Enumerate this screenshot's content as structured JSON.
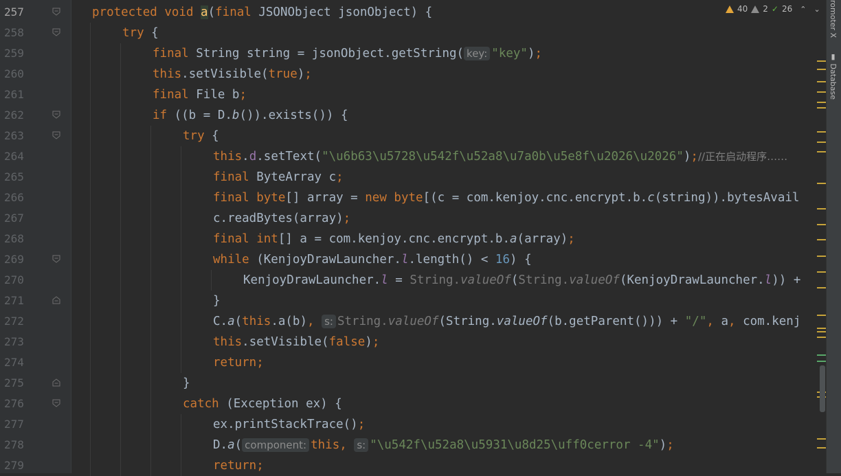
{
  "editor": {
    "lines": [
      {
        "n": "257",
        "indent": 0,
        "fold": "open",
        "tokens": [
          {
            "t": "protected void ",
            "c": "kw"
          },
          {
            "t": "a",
            "c": "hlname"
          },
          {
            "t": "(",
            "c": ""
          },
          {
            "t": "final ",
            "c": "kw"
          },
          {
            "t": "JSONObject jsonObject) {",
            "c": ""
          }
        ]
      },
      {
        "n": "258",
        "indent": 1,
        "fold": "open",
        "tokens": [
          {
            "t": "try ",
            "c": "kw"
          },
          {
            "t": "{",
            "c": ""
          }
        ]
      },
      {
        "n": "259",
        "indent": 2,
        "fold": "",
        "tokens": [
          {
            "t": "final ",
            "c": "kw"
          },
          {
            "t": "String string = jsonObject.getString(",
            "c": ""
          },
          {
            "t": "key:",
            "c": "hint"
          },
          {
            "t": "\"key\"",
            "c": "str"
          },
          {
            "t": ")",
            "c": ""
          },
          {
            "t": ";",
            "c": "kw"
          }
        ]
      },
      {
        "n": "260",
        "indent": 2,
        "fold": "",
        "tokens": [
          {
            "t": "this",
            "c": "kw"
          },
          {
            "t": ".setVisible(",
            "c": ""
          },
          {
            "t": "true",
            "c": "kw"
          },
          {
            "t": ")",
            "c": ""
          },
          {
            "t": ";",
            "c": "kw"
          }
        ]
      },
      {
        "n": "261",
        "indent": 2,
        "fold": "",
        "tokens": [
          {
            "t": "final ",
            "c": "kw"
          },
          {
            "t": "File b",
            "c": ""
          },
          {
            "t": ";",
            "c": "kw"
          }
        ]
      },
      {
        "n": "262",
        "indent": 2,
        "fold": "open",
        "tokens": [
          {
            "t": "if ",
            "c": "kw"
          },
          {
            "t": "((b = D.",
            "c": ""
          },
          {
            "t": "b",
            "c": "it"
          },
          {
            "t": "()).exists()) {",
            "c": ""
          }
        ]
      },
      {
        "n": "263",
        "indent": 3,
        "fold": "open",
        "tokens": [
          {
            "t": "try ",
            "c": "kw"
          },
          {
            "t": "{",
            "c": ""
          }
        ]
      },
      {
        "n": "264",
        "indent": 4,
        "fold": "",
        "tokens": [
          {
            "t": "this",
            "c": "kw"
          },
          {
            "t": ".",
            "c": ""
          },
          {
            "t": "d",
            "c": "fld"
          },
          {
            "t": ".setText(",
            "c": ""
          },
          {
            "t": "\"\\u6b63\\u5728\\u542f\\u52a8\\u7a0b\\u5e8f\\u2026\\u2026\"",
            "c": "str"
          },
          {
            "t": ")",
            "c": ""
          },
          {
            "t": ";",
            "c": "kw"
          },
          {
            "t": "//正在启动程序……",
            "c": "cmt"
          }
        ]
      },
      {
        "n": "265",
        "indent": 4,
        "fold": "",
        "tokens": [
          {
            "t": "final ",
            "c": "kw"
          },
          {
            "t": "ByteArray c",
            "c": ""
          },
          {
            "t": ";",
            "c": "kw"
          }
        ]
      },
      {
        "n": "266",
        "indent": 4,
        "fold": "",
        "tokens": [
          {
            "t": "final byte",
            "c": "kw"
          },
          {
            "t": "[] array = ",
            "c": ""
          },
          {
            "t": "new byte",
            "c": "kw"
          },
          {
            "t": "[(c = com.kenjoy.cnc.encrypt.b.",
            "c": ""
          },
          {
            "t": "c",
            "c": "it"
          },
          {
            "t": "(string)).bytesAvail",
            "c": ""
          }
        ]
      },
      {
        "n": "267",
        "indent": 4,
        "fold": "",
        "tokens": [
          {
            "t": "c.readBytes(array)",
            "c": ""
          },
          {
            "t": ";",
            "c": "kw"
          }
        ]
      },
      {
        "n": "268",
        "indent": 4,
        "fold": "",
        "tokens": [
          {
            "t": "final int",
            "c": "kw"
          },
          {
            "t": "[] a = com.kenjoy.cnc.encrypt.b.",
            "c": ""
          },
          {
            "t": "a",
            "c": "it"
          },
          {
            "t": "(array)",
            "c": ""
          },
          {
            "t": ";",
            "c": "kw"
          }
        ]
      },
      {
        "n": "269",
        "indent": 4,
        "fold": "open",
        "tokens": [
          {
            "t": "while ",
            "c": "kw"
          },
          {
            "t": "(KenjoyDrawLauncher.",
            "c": ""
          },
          {
            "t": "l",
            "c": "st"
          },
          {
            "t": ".length() < ",
            "c": ""
          },
          {
            "t": "16",
            "c": "num"
          },
          {
            "t": ") {",
            "c": ""
          }
        ]
      },
      {
        "n": "270",
        "indent": 5,
        "fold": "",
        "tokens": [
          {
            "t": "KenjoyDrawLauncher.",
            "c": ""
          },
          {
            "t": "l",
            "c": "st"
          },
          {
            "t": " = ",
            "c": ""
          },
          {
            "t": "String.",
            "c": "gray"
          },
          {
            "t": "valueOf",
            "c": "gray it"
          },
          {
            "t": "(",
            "c": ""
          },
          {
            "t": "String.",
            "c": "gray"
          },
          {
            "t": "valueOf",
            "c": "gray it"
          },
          {
            "t": "(KenjoyDrawLauncher.",
            "c": ""
          },
          {
            "t": "l",
            "c": "st"
          },
          {
            "t": ")) +",
            "c": ""
          }
        ]
      },
      {
        "n": "271",
        "indent": 4,
        "fold": "close",
        "tokens": [
          {
            "t": "}",
            "c": ""
          }
        ]
      },
      {
        "n": "272",
        "indent": 4,
        "fold": "",
        "tokens": [
          {
            "t": "C.",
            "c": ""
          },
          {
            "t": "a",
            "c": "it"
          },
          {
            "t": "(",
            "c": ""
          },
          {
            "t": "this",
            "c": "kw"
          },
          {
            "t": ".a(b)",
            "c": ""
          },
          {
            "t": ", ",
            "c": "kw"
          },
          {
            "t": "s:",
            "c": "hint"
          },
          {
            "t": "String.",
            "c": "gray"
          },
          {
            "t": "valueOf",
            "c": "gray it"
          },
          {
            "t": "(String.",
            "c": ""
          },
          {
            "t": "valueOf",
            "c": "it"
          },
          {
            "t": "(b.getParent())) + ",
            "c": ""
          },
          {
            "t": "\"/\"",
            "c": "str"
          },
          {
            "t": ", ",
            "c": "kw"
          },
          {
            "t": "a",
            "c": ""
          },
          {
            "t": ", ",
            "c": "kw"
          },
          {
            "t": "com.kenj",
            "c": ""
          }
        ]
      },
      {
        "n": "273",
        "indent": 4,
        "fold": "",
        "tokens": [
          {
            "t": "this",
            "c": "kw"
          },
          {
            "t": ".setVisible(",
            "c": ""
          },
          {
            "t": "false",
            "c": "kw"
          },
          {
            "t": ")",
            "c": ""
          },
          {
            "t": ";",
            "c": "kw"
          }
        ]
      },
      {
        "n": "274",
        "indent": 4,
        "fold": "",
        "tokens": [
          {
            "t": "return;",
            "c": "kw"
          }
        ]
      },
      {
        "n": "275",
        "indent": 3,
        "fold": "close",
        "tokens": [
          {
            "t": "}",
            "c": ""
          }
        ]
      },
      {
        "n": "276",
        "indent": 3,
        "fold": "open",
        "tokens": [
          {
            "t": "catch ",
            "c": "kw"
          },
          {
            "t": "(Exception ex) {",
            "c": ""
          }
        ]
      },
      {
        "n": "277",
        "indent": 4,
        "fold": "",
        "tokens": [
          {
            "t": "ex.printStackTrace()",
            "c": ""
          },
          {
            "t": ";",
            "c": "kw"
          }
        ]
      },
      {
        "n": "278",
        "indent": 4,
        "fold": "",
        "tokens": [
          {
            "t": "D.",
            "c": ""
          },
          {
            "t": "a",
            "c": "it"
          },
          {
            "t": "(",
            "c": ""
          },
          {
            "t": "component:",
            "c": "hint"
          },
          {
            "t": "this",
            "c": "kw"
          },
          {
            "t": ", ",
            "c": "kw"
          },
          {
            "t": "s:",
            "c": "hint"
          },
          {
            "t": "\"\\u542f\\u52a8\\u5931\\u8d25\\uff0cerror -4\"",
            "c": "str"
          },
          {
            "t": ")",
            "c": ""
          },
          {
            "t": ";",
            "c": "kw"
          }
        ]
      },
      {
        "n": "279",
        "indent": 4,
        "fold": "",
        "tokens": [
          {
            "t": "return;",
            "c": "kw"
          }
        ]
      }
    ]
  },
  "inspections": {
    "warnings": "40",
    "weak_warnings": "2",
    "ok": "26"
  },
  "toolwindows": {
    "top_label": "romoter X",
    "database_label": "Database"
  },
  "colors": {
    "keyword": "#cc7832",
    "string": "#6a8759",
    "number": "#6897bb",
    "field": "#9876aa",
    "background": "#2b2b2b",
    "gutter": "#313335"
  }
}
